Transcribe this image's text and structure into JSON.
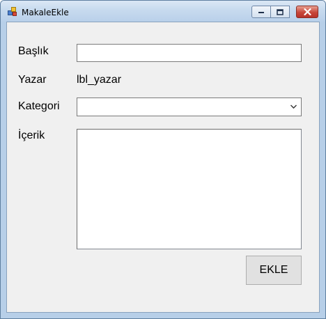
{
  "window": {
    "title": "MakaleEkle"
  },
  "labels": {
    "title": "Başlık",
    "author": "Yazar",
    "author_value": "lbl_yazar",
    "category": "Kategori",
    "content": "İçerik"
  },
  "fields": {
    "title_value": "",
    "category_value": "",
    "content_value": ""
  },
  "buttons": {
    "add": "EKLE"
  },
  "icons": {
    "app": "form-icon",
    "minimize": "minimize-icon",
    "maximize": "maximize-icon",
    "close": "close-icon",
    "dropdown": "chevron-down-icon"
  }
}
